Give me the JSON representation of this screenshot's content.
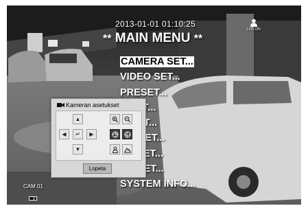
{
  "header": {
    "datetime": "2013-01-01 01:10:25",
    "logon_label": "LOG ON"
  },
  "main_menu": {
    "title_prefix": "**",
    "title": "MAIN MENU",
    "title_suffix": "**",
    "items": [
      {
        "label": "CAMERA SET...",
        "selected": true
      },
      {
        "label": "VIDEO SET..."
      },
      {
        "label": "PRESET..."
      },
      {
        "label": "E SET..."
      },
      {
        "label": "O SET..."
      },
      {
        "label": "RM SET..."
      },
      {
        "label": "ER SET..."
      },
      {
        "label": "CK SET..."
      },
      {
        "label": "SYSTEM INFO..."
      }
    ]
  },
  "ptz_popup": {
    "title": "Kameran asetukset",
    "quit_label": "Lopeta",
    "controls": {
      "up": "▲",
      "down": "▼",
      "left": "◀",
      "right": "▶",
      "center": "↵"
    }
  },
  "camera": {
    "label": "CAM 01"
  }
}
